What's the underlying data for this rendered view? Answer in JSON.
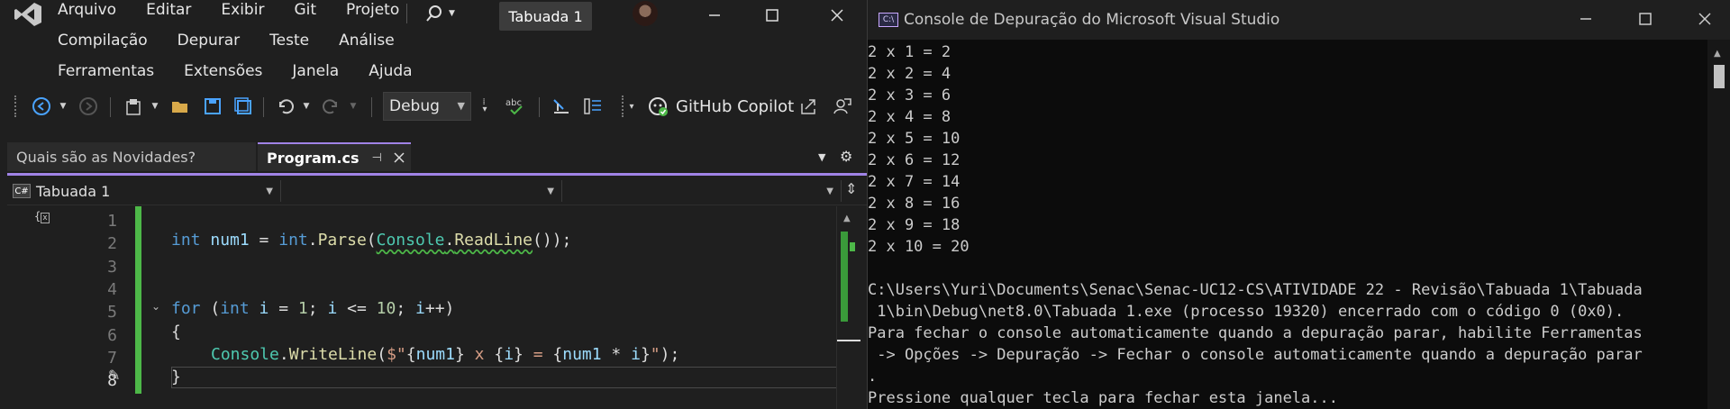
{
  "vs": {
    "menu": {
      "row1": [
        "Arquivo",
        "Editar",
        "Exibir",
        "Git",
        "Projeto"
      ],
      "row2": [
        "Compilação",
        "Depurar",
        "Teste",
        "Análise"
      ],
      "row3": [
        "Ferramentas",
        "Extensões",
        "Janela",
        "Ajuda"
      ]
    },
    "solution_name": "Tabuada 1",
    "toolbar": {
      "config": "Debug",
      "copilot_label": "GitHub Copilot"
    },
    "tabs": [
      {
        "label": "Quais são as Novidades?"
      },
      {
        "label": "Program.cs"
      }
    ],
    "nav": {
      "project": "Tabuada 1",
      "cs_badge": "C#"
    },
    "line_numbers": [
      "1",
      "2",
      "3",
      "4",
      "5",
      "6",
      "7",
      "8"
    ],
    "accent": "#a083e6",
    "change_color": "#4db848"
  },
  "code": {
    "l2": {
      "kw1": "int",
      "v1": "num1",
      "eq": " = ",
      "kw2": "int",
      "dot1": ".",
      "fn1": "Parse",
      "p1": "(",
      "ty1": "Console",
      "dot2": ".",
      "fn2": "ReadLine",
      "p2": "());"
    },
    "l5": {
      "kw": "for",
      "p1": " (",
      "kw2": "int",
      "v1": " i",
      "p2": " = ",
      "n1": "1",
      "p3": "; ",
      "v2": "i",
      "p4": " <= ",
      "n2": "10",
      "p5": "; ",
      "v3": "i",
      "p6": "++)"
    },
    "l6": "{",
    "l7": {
      "ty": "Console",
      "dot": ".",
      "fn": "WriteLine",
      "p1": "(",
      "s1": "$\"",
      "b1": "{",
      "v1": "num1",
      "b2": "}",
      "s2": " x ",
      "b3": "{",
      "v2": "i",
      "b4": "}",
      "s3": " = ",
      "b5": "{",
      "v3": "num1",
      "op": " * ",
      "v4": "i",
      "b6": "}",
      "s4": "\"",
      "p2": ");"
    },
    "l8": "}"
  },
  "console": {
    "title": "Console de Depuração do Microsoft Visual Studio",
    "icon_text": "C:\\",
    "lines": [
      "2 x 1 = 2",
      "2 x 2 = 4",
      "2 x 3 = 6",
      "2 x 4 = 8",
      "2 x 5 = 10",
      "2 x 6 = 12",
      "2 x 7 = 14",
      "2 x 8 = 16",
      "2 x 9 = 18",
      "2 x 10 = 20",
      "",
      "C:\\Users\\Yuri\\Documents\\Senac\\Senac-UC12-CS\\ATIVIDADE 22 - Revisão\\Tabuada 1\\Tabuada",
      " 1\\bin\\Debug\\net8.0\\Tabuada 1.exe (processo 19320) encerrado com o código 0 (0x0).",
      "Para fechar o console automaticamente quando a depuração parar, habilite Ferramentas",
      " -> Opções -> Depuração -> Fechar o console automaticamente quando a depuração parar",
      ".",
      "Pressione qualquer tecla para fechar esta janela..."
    ]
  }
}
